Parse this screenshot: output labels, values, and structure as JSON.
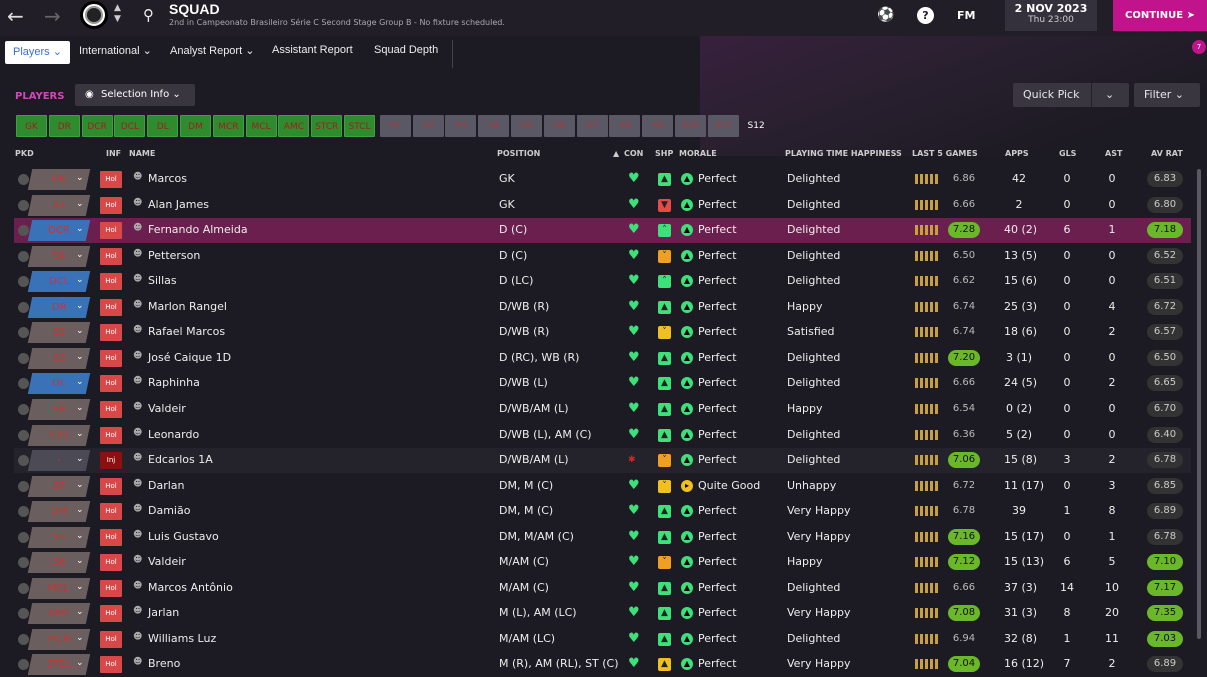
{
  "top": {
    "title": "SQUAD",
    "subtitle": "2nd in Campeonato Brasileiro Série C Second Stage Group B - No fixture scheduled.",
    "date": "2 NOV 2023",
    "time": "Thu 23:00",
    "continue": "CONTINUE",
    "fm": "FM",
    "help": "?"
  },
  "tabs": [
    "Players",
    "International",
    "Analyst Report",
    "Assistant Report",
    "Squad Depth"
  ],
  "notif": "7",
  "players_label": "PLAYERS",
  "selection_info": "Selection Info",
  "quick_pick": "Quick Pick",
  "filter": "Filter",
  "chips": [
    "GK",
    "DR",
    "DCR",
    "DCL",
    "DL",
    "DM",
    "MCR",
    "MCL",
    "AMC",
    "STCR",
    "STCL",
    "S1",
    "S2",
    "S3",
    "S4",
    "S5",
    "S6",
    "S7",
    "S8",
    "S9",
    "S10",
    "S11",
    "S12"
  ],
  "headers": {
    "pkd": "PKD",
    "inf": "INF",
    "name": "NAME",
    "position": "POSITION",
    "con": "CON",
    "shp": "SHP",
    "morale": "MORALE",
    "pth": "PLAYING TIME HAPPINESS",
    "last5": "LAST 5 GAMES",
    "apps": "APPS",
    "gls": "GLS",
    "ast": "AST",
    "avrat": "AV RAT"
  },
  "rows": [
    {
      "pkd": "GK",
      "inf": "Hol",
      "name": "Marcos",
      "position": "GK",
      "morale": "Perfect",
      "pth": "Delighted",
      "l5": "6.86",
      "apps": "42",
      "gls": "0",
      "ast": "0",
      "av": "6.83"
    },
    {
      "pkd": "S1",
      "inf": "Hol",
      "name": "Alan James",
      "position": "GK",
      "morale": "Perfect",
      "pth": "Delighted",
      "l5": "6.66",
      "apps": "2",
      "gls": "0",
      "ast": "0",
      "av": "6.80"
    },
    {
      "pkd": "DCR",
      "inf": "Hol",
      "name": "Fernando Almeida",
      "position": "D (C)",
      "morale": "Perfect",
      "pth": "Delighted",
      "l5": "7.28",
      "apps": "40 (2)",
      "gls": "6",
      "ast": "1",
      "av": "7.18"
    },
    {
      "pkd": "S4",
      "inf": "Hol",
      "name": "Petterson",
      "position": "D (C)",
      "morale": "Perfect",
      "pth": "Delighted",
      "l5": "6.50",
      "apps": "13 (5)",
      "gls": "0",
      "ast": "0",
      "av": "6.52"
    },
    {
      "pkd": "DCL",
      "inf": "Hol",
      "name": "Sillas",
      "position": "D (LC)",
      "morale": "Perfect",
      "pth": "Delighted",
      "l5": "6.62",
      "apps": "15 (6)",
      "gls": "0",
      "ast": "0",
      "av": "6.51"
    },
    {
      "pkd": "DR",
      "inf": "Hol",
      "name": "Marlon Rangel",
      "position": "D/WB (R)",
      "morale": "Perfect",
      "pth": "Happy",
      "l5": "6.74",
      "apps": "25 (3)",
      "gls": "0",
      "ast": "4",
      "av": "6.72"
    },
    {
      "pkd": "S2",
      "inf": "Hol",
      "name": "Rafael Marcos",
      "position": "D/WB (R)",
      "morale": "Perfect",
      "pth": "Satisfied",
      "l5": "6.74",
      "apps": "18 (6)",
      "gls": "0",
      "ast": "2",
      "av": "6.57"
    },
    {
      "pkd": "S3",
      "inf": "Hol",
      "name": "José Caique 1D",
      "position": "D (RC), WB (R)",
      "morale": "Perfect",
      "pth": "Delighted",
      "l5": "7.20",
      "apps": "3 (1)",
      "gls": "0",
      "ast": "0",
      "av": "6.50"
    },
    {
      "pkd": "DL",
      "inf": "Hol",
      "name": "Raphinha",
      "position": "D/WB (L)",
      "morale": "Perfect",
      "pth": "Delighted",
      "l5": "6.66",
      "apps": "24 (5)",
      "gls": "0",
      "ast": "2",
      "av": "6.65"
    },
    {
      "pkd": "S8",
      "inf": "Hol",
      "name": "Valdeir",
      "position": "D/WB/AM (L)",
      "morale": "Perfect",
      "pth": "Happy",
      "l5": "6.54",
      "apps": "0 (2)",
      "gls": "0",
      "ast": "0",
      "av": "6.70"
    },
    {
      "pkd": "S10",
      "inf": "Hol",
      "name": "Leonardo",
      "position": "D/WB (L), AM (C)",
      "morale": "Perfect",
      "pth": "Delighted",
      "l5": "6.36",
      "apps": "5 (2)",
      "gls": "0",
      "ast": "0",
      "av": "6.40"
    },
    {
      "pkd": "-",
      "inf": "Inj",
      "name": "Edcarlos 1A",
      "position": "D/WB/AM (L)",
      "morale": "Perfect",
      "pth": "Delighted",
      "l5": "7.06",
      "apps": "15 (8)",
      "gls": "3",
      "ast": "2",
      "av": "6.78"
    },
    {
      "pkd": "S7",
      "inf": "Hol",
      "name": "Darlan",
      "position": "DM, M (C)",
      "morale": "Quite Good",
      "pth": "Unhappy",
      "l5": "6.72",
      "apps": "11 (17)",
      "gls": "0",
      "ast": "3",
      "av": "6.85"
    },
    {
      "pkd": "DM",
      "inf": "Hol",
      "name": "Damião",
      "position": "DM, M (C)",
      "morale": "Perfect",
      "pth": "Very Happy",
      "l5": "6.78",
      "apps": "39",
      "gls": "1",
      "ast": "8",
      "av": "6.89"
    },
    {
      "pkd": "S5",
      "inf": "Hol",
      "name": "Luis Gustavo",
      "position": "DM, M/AM (C)",
      "morale": "Perfect",
      "pth": "Very Happy",
      "l5": "7.16",
      "apps": "15 (17)",
      "gls": "0",
      "ast": "1",
      "av": "6.78"
    },
    {
      "pkd": "S6",
      "inf": "Hol",
      "name": "Valdeir",
      "position": "M/AM (C)",
      "morale": "Perfect",
      "pth": "Happy",
      "l5": "7.12",
      "apps": "15 (13)",
      "gls": "6",
      "ast": "5",
      "av": "7.10"
    },
    {
      "pkd": "MCL",
      "inf": "Hol",
      "name": "Marcos Antônio",
      "position": "M/AM (C)",
      "morale": "Perfect",
      "pth": "Delighted",
      "l5": "6.66",
      "apps": "37 (3)",
      "gls": "14",
      "ast": "10",
      "av": "7.17"
    },
    {
      "pkd": "AMC",
      "inf": "Hol",
      "name": "Jarlan",
      "position": "M (L), AM (LC)",
      "morale": "Perfect",
      "pth": "Very Happy",
      "l5": "7.08",
      "apps": "31 (3)",
      "gls": "8",
      "ast": "20",
      "av": "7.35"
    },
    {
      "pkd": "MCR",
      "inf": "Hol",
      "name": "Williams Luz",
      "position": "M/AM (LC)",
      "morale": "Perfect",
      "pth": "Delighted",
      "l5": "6.94",
      "apps": "32 (8)",
      "gls": "1",
      "ast": "11",
      "av": "7.03"
    },
    {
      "pkd": "STCL",
      "inf": "Hol",
      "name": "Breno",
      "position": "M (R), AM (RL), ST (C)",
      "morale": "Perfect",
      "pth": "Very Happy",
      "l5": "7.04",
      "apps": "16 (12)",
      "gls": "7",
      "ast": "2",
      "av": "6.89"
    }
  ]
}
